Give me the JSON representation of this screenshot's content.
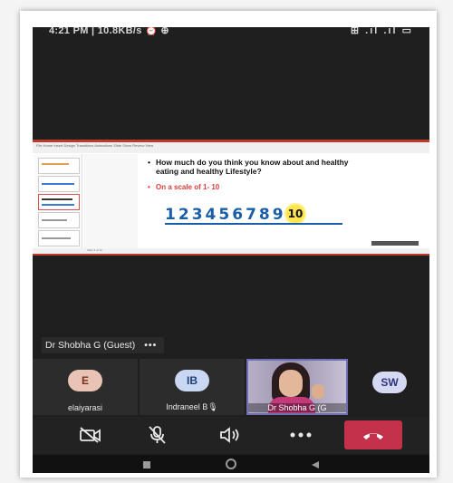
{
  "status_bar": {
    "time": "4:21 PM | 10.8KB/s ⏰ ⊕",
    "icons": "⊞ .ıl .ıl ▭"
  },
  "shared_slide": {
    "ribbon_tabs": "File  Home  Insert  Design  Transitions  Animations  Slide Show  Review  View",
    "question": "How much do you think you know about and healthy eating and healthy Lifestyle?",
    "scale_text": "On a scale of  1- 10",
    "scale_numbers": [
      "1",
      "2",
      "3",
      "4",
      "5",
      "6",
      "7",
      "8",
      "9",
      "10"
    ],
    "status_text": "Slide 3 of 12"
  },
  "presenter": {
    "name": "Dr Shobha G (Guest)",
    "more": "•••"
  },
  "participants": [
    {
      "initials": "E",
      "name": "elaiyarasi",
      "avatar_bg": "#e9c4b4",
      "avatar_fg": "#7a2f1e"
    },
    {
      "initials": "IB",
      "name": "Indraneel B🎙",
      "avatar_bg": "#c9d7f2",
      "avatar_fg": "#1e3f7a"
    },
    {
      "name": "Dr Shobha G (G"
    },
    {
      "initials": "SW",
      "avatar_bg": "#d5d9f2",
      "avatar_fg": "#2c357a"
    }
  ],
  "colors": {
    "end_call": "#c4314b",
    "accent": "#6f6fb8"
  },
  "controls": [
    {
      "icon": "video-off-icon"
    },
    {
      "icon": "mic-off-icon"
    },
    {
      "icon": "speaker-icon"
    },
    {
      "icon": "more-icon"
    },
    {
      "icon": "end-call-icon"
    }
  ],
  "nav": [
    {
      "icon": "recent-apps-icon"
    },
    {
      "icon": "home-icon"
    },
    {
      "icon": "back-icon"
    }
  ]
}
